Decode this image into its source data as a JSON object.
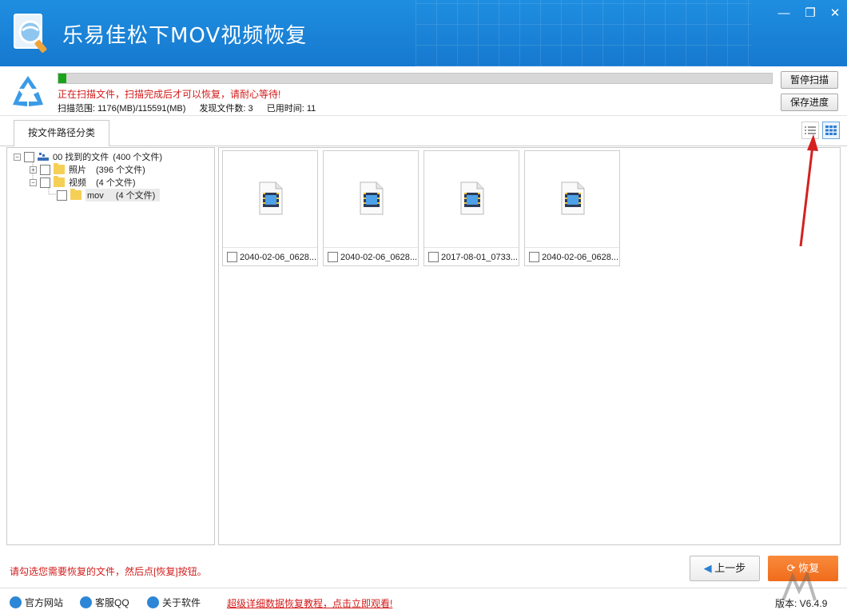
{
  "app": {
    "title": "乐易佳松下MOV视频恢复"
  },
  "window_controls": {
    "minimize": "—",
    "maximize": "❐",
    "close": "✕"
  },
  "scan": {
    "progress": 0.011,
    "status": "正在扫描文件，扫描完成后才可以恢复，请耐心等待!",
    "range": "扫描范围: 1176(MB)/115591(MB)",
    "found": "发现文件数: 3",
    "elapsed": "已用时间: 11",
    "pause_label": "暂停扫描",
    "save_label": "保存进度"
  },
  "tabs": [
    {
      "label": "按文件路径分类"
    }
  ],
  "view_toggle": {
    "list": "list-view-icon",
    "grid": "grid-view-icon",
    "active": "grid"
  },
  "tree": {
    "root": {
      "name": "00 找到的文件",
      "count": "(400 个文件)"
    },
    "photos": {
      "name": "照片",
      "count": "(396 个文件)"
    },
    "videos": {
      "name": "视频",
      "count": "(4 个文件)"
    },
    "mov": {
      "name": "mov",
      "count": "(4 个文件)"
    }
  },
  "files": [
    {
      "name": "2040-02-06_0628..."
    },
    {
      "name": "2040-02-06_0628..."
    },
    {
      "name": "2017-08-01_0733..."
    },
    {
      "name": "2040-02-06_0628..."
    }
  ],
  "bottom": {
    "hint": "请勾选您需要恢复的文件，然后点[恢复]按钮。",
    "back_label": "上一步",
    "recover_label": "恢复"
  },
  "footer": {
    "website": "官方网站",
    "qq": "客服QQ",
    "about": "关于软件",
    "promo": "超级详细数据恢复教程，点击立即观看!",
    "version": "版本: V6.4.9"
  },
  "colors": {
    "titlebar": "#1b86d9",
    "progress": "#19a31b",
    "alert": "#d21b1b",
    "recover": "#f47a2a",
    "annotation_arrow": "#d42020"
  }
}
